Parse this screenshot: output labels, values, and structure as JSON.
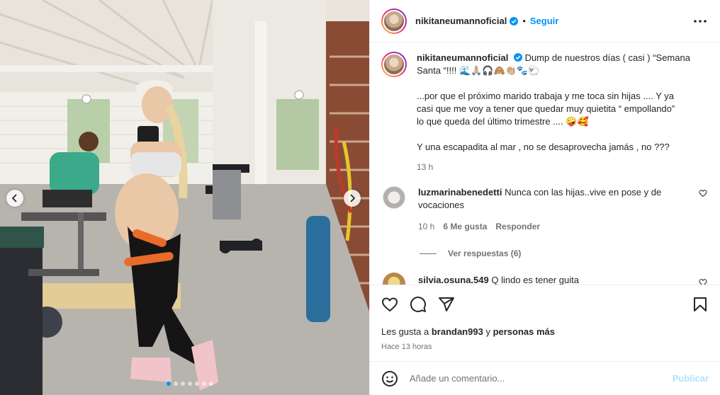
{
  "post": {
    "username": "nikitaneumannoficial",
    "separator": "•",
    "follow_label": "Seguir",
    "caption_line1": "Dump de nuestros días ( casi ) “Semana",
    "caption_line2": "Santa “!!!! 🌊🙏🏼🎧🙈👏🏼🐾🐑",
    "caption_p2_line1": "...por que el próximo marido trabaja y me toca sin hijas .... Y ya",
    "caption_p2_line2": "casi que me voy a tener que quedar muy quietita “ empollando”",
    "caption_p2_line3": "lo que queda del último trimestre .... 🤪🥰",
    "caption_p3_line1": "Y una escapadita al mar , no se desaprovecha jamás , no ???",
    "caption_time": "13 h"
  },
  "comments": [
    {
      "username": "luzmarinabenedetti",
      "text_line1": "Nunca con las hijas..vive en pose y de",
      "text_line2": "vocaciones",
      "time": "10 h",
      "likes": "6 Me gusta",
      "reply_label": "Responder",
      "view_replies": "Ver respuestas (6)"
    },
    {
      "username": "silvia.osuna.549",
      "text": "Q lindo es tener guita"
    }
  ],
  "footer": {
    "likes_prefix": "Les gusta a",
    "likes_user": "brandan993",
    "likes_mid": "y",
    "likes_others": "personas más",
    "time_ago": "Hace 13 horas",
    "comment_placeholder": "Añade un comentario...",
    "publish_label": "Publicar"
  },
  "carousel": {
    "dot_count": 7,
    "active_index": 0
  },
  "icons": [
    "verified-badge-icon",
    "more-options-icon",
    "heart-icon",
    "comment-icon",
    "share-icon",
    "bookmark-icon",
    "emoji-icon",
    "chevron-left-icon",
    "chevron-right-icon"
  ],
  "colors": {
    "accent": "#0095f6",
    "publish_disabled": "#b2dffc",
    "muted": "#737373"
  }
}
